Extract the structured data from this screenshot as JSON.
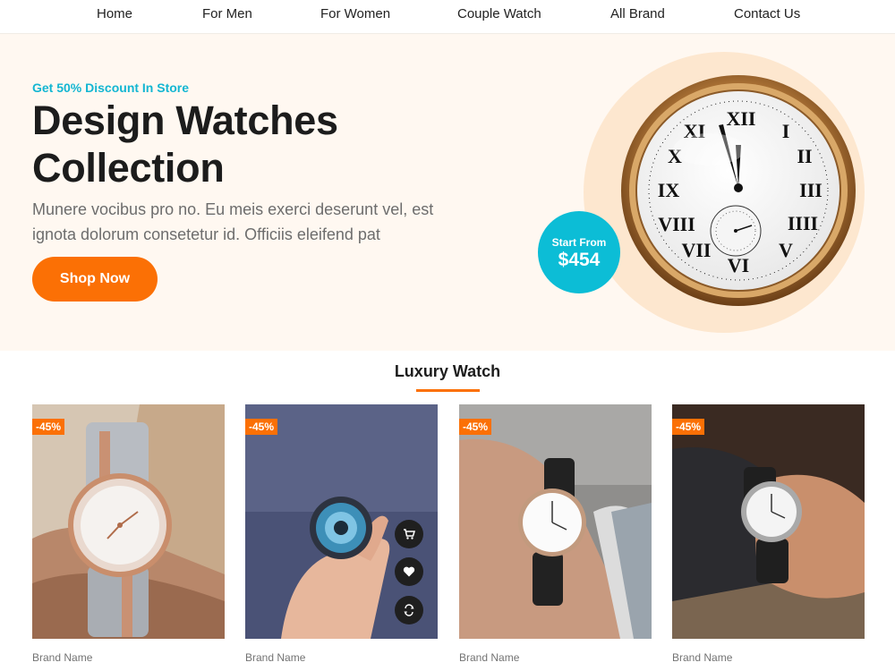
{
  "nav": {
    "items": [
      {
        "label": "Home"
      },
      {
        "label": "For Men"
      },
      {
        "label": "For Women"
      },
      {
        "label": "Couple Watch"
      },
      {
        "label": "All Brand"
      },
      {
        "label": "Contact Us"
      }
    ]
  },
  "hero": {
    "kicker": "Get 50% Discount In Store",
    "title_line1": "Design Watches",
    "title_line2": "Collection",
    "description": "Munere vocibus pro no. Eu meis exerci deserunt vel, est ignota dolorum consetetur id. Officiis eleifend pat",
    "button_label": "Shop Now",
    "price_label": "Start From",
    "price_value": "$454"
  },
  "section": {
    "title": "Luxury Watch"
  },
  "products": [
    {
      "discount": "-45%",
      "brand": "Brand Name"
    },
    {
      "discount": "-45%",
      "brand": "Brand Name"
    },
    {
      "discount": "-45%",
      "brand": "Brand Name"
    },
    {
      "discount": "-45%",
      "brand": "Brand Name"
    }
  ],
  "colors": {
    "accent_orange": "#fb7005",
    "accent_cyan": "#0cbdd6",
    "hero_background": "#fff8f1"
  },
  "icons": [
    "cart-icon",
    "heart-icon",
    "compare-icon"
  ]
}
